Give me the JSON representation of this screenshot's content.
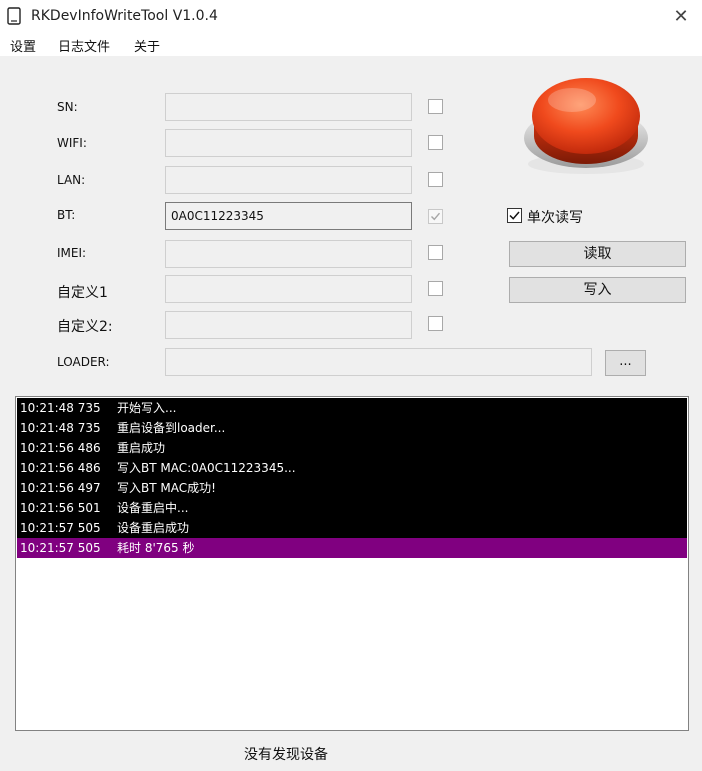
{
  "window": {
    "title": "RKDevInfoWriteTool V1.0.4",
    "close_glyph": "✕"
  },
  "menu": [
    "设置",
    "日志文件",
    "关于"
  ],
  "fields": [
    {
      "label": "SN:",
      "value": "",
      "checked": false
    },
    {
      "label": "WIFI:",
      "value": "",
      "checked": false
    },
    {
      "label": "LAN:",
      "value": "",
      "checked": false
    },
    {
      "label": "BT:",
      "value": "0A0C11223345",
      "checked": true
    },
    {
      "label": "IMEI:",
      "value": "",
      "checked": false
    },
    {
      "label": "自定义1",
      "value": "",
      "checked": false
    },
    {
      "label": "自定义2:",
      "value": "",
      "checked": false
    }
  ],
  "loader": {
    "label": "LOADER:",
    "value": "",
    "browse_label": "..."
  },
  "options": {
    "single_rw_label": "单次读写",
    "single_rw_checked": true
  },
  "buttons": {
    "read": "读取",
    "write": "写入"
  },
  "log": [
    {
      "time": "10:21:48 735",
      "message": "开始写入...",
      "selected": false
    },
    {
      "time": "10:21:48 735",
      "message": "重启设备到loader...",
      "selected": false
    },
    {
      "time": "10:21:56 486",
      "message": "重启成功",
      "selected": false
    },
    {
      "time": "10:21:56 486",
      "message": "写入BT MAC:0A0C11223345...",
      "selected": false
    },
    {
      "time": "10:21:56 497",
      "message": "写入BT MAC成功!",
      "selected": false
    },
    {
      "time": "10:21:56 501",
      "message": "设备重启中...",
      "selected": false
    },
    {
      "time": "10:21:57 505",
      "message": "设备重启成功",
      "selected": false
    },
    {
      "time": "10:21:57 505",
      "message": "耗时 8'765 秒",
      "selected": true
    }
  ],
  "status": {
    "text": "没有发现设备"
  },
  "colors": {
    "log_background": "#000000",
    "log_selected": "#800080",
    "button_red": "#e8401c"
  }
}
